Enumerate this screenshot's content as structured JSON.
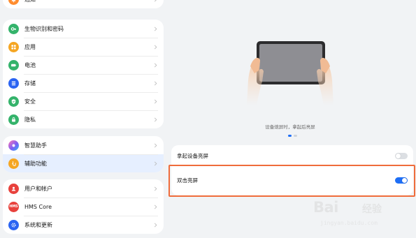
{
  "sidebar": {
    "partial_top": {
      "label": "通知",
      "icon": "bell-icon",
      "color": "#ff8c2e"
    },
    "group1": [
      {
        "label": "生物识别和密码",
        "icon": "key-icon",
        "color": "#34b36b"
      },
      {
        "label": "应用",
        "icon": "apps-icon",
        "color": "#f5a623"
      },
      {
        "label": "电池",
        "icon": "battery-icon",
        "color": "#34b36b"
      },
      {
        "label": "存储",
        "icon": "storage-icon",
        "color": "#2b64f2"
      },
      {
        "label": "安全",
        "icon": "shield-icon",
        "color": "#34b36b"
      },
      {
        "label": "隐私",
        "icon": "privacy-icon",
        "color": "#34b36b"
      }
    ],
    "group2": [
      {
        "label": "智慧助手",
        "icon": "assistant-icon",
        "color": "#b45cf0"
      },
      {
        "label": "辅助功能",
        "icon": "accessibility-icon",
        "color": "#f5a623",
        "selected": true
      }
    ],
    "group3": [
      {
        "label": "用户和帐户",
        "icon": "user-icon",
        "color": "#e8413c"
      },
      {
        "label": "HMS Core",
        "icon": "hms-core-icon",
        "color": "#e8413c"
      },
      {
        "label": "系统和更新",
        "icon": "system-update-icon",
        "color": "#2b64f2"
      }
    ]
  },
  "main": {
    "caption": "设备熄屏时，拿起后亮屏",
    "carousel_active_index": 0,
    "settings": [
      {
        "label": "拿起设备亮屏",
        "enabled": false
      },
      {
        "label": "双击亮屏",
        "enabled": true
      }
    ]
  },
  "watermark": {
    "brand": "Bai",
    "sub": "经验",
    "url": "jingyan.baidu.com"
  },
  "colors": {
    "accent": "#1e6ef5",
    "highlight": "#ef6c3b",
    "background": "#f1f3f5"
  }
}
